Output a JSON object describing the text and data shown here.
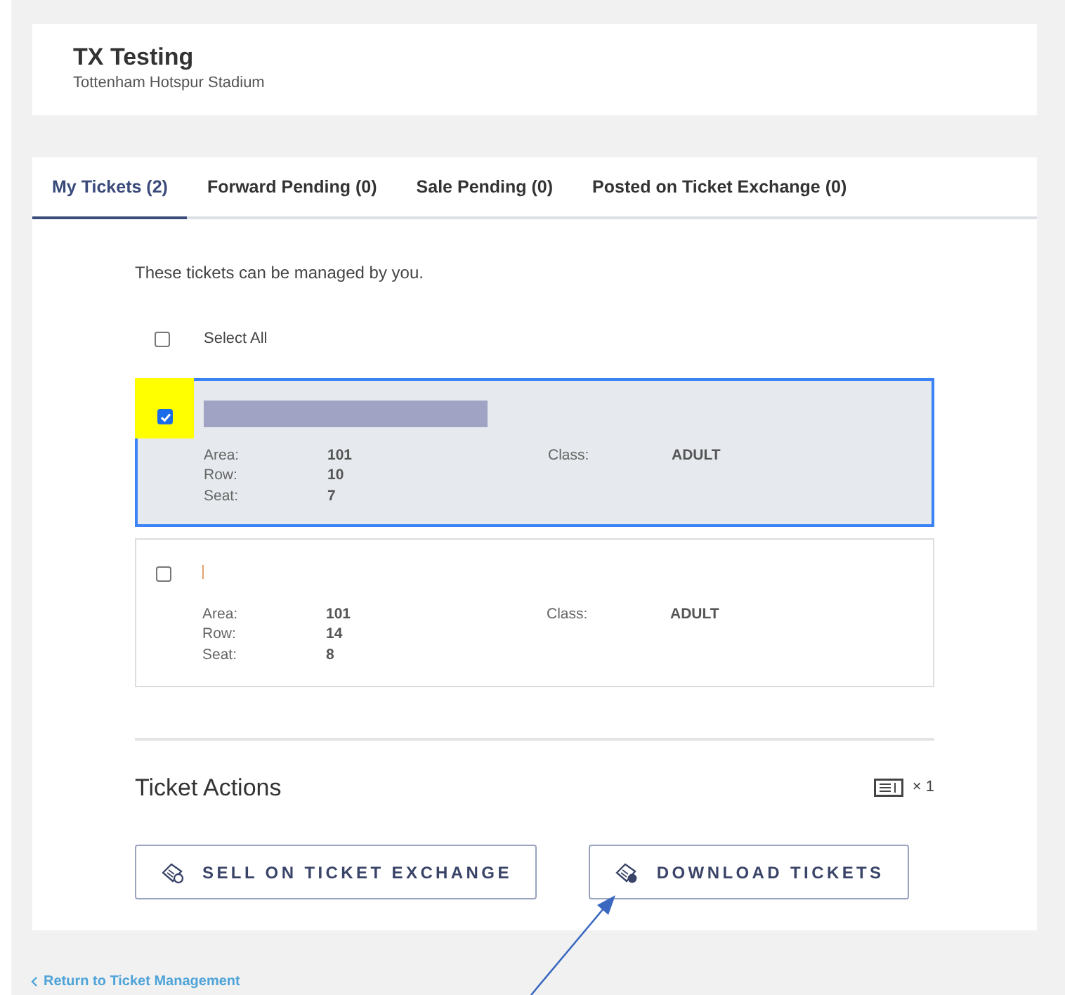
{
  "event": {
    "title": "TX Testing",
    "venue": "Tottenham Hotspur Stadium"
  },
  "tabs": [
    {
      "label": "My Tickets (2)",
      "selected": true
    },
    {
      "label": "Forward Pending (0)",
      "selected": false
    },
    {
      "label": "Sale Pending (0)",
      "selected": false
    },
    {
      "label": "Posted on Ticket Exchange (0)",
      "selected": false
    }
  ],
  "intro": "These tickets can be managed by you.",
  "select_all": {
    "label": "Select All",
    "checked": false
  },
  "tickets": [
    {
      "checked": true,
      "highlighted": true,
      "kind": "redacted",
      "fields": [
        {
          "label": "Area:",
          "value": "101"
        },
        {
          "label": "Row:",
          "value": "10"
        },
        {
          "label": "Seat:",
          "value": "7"
        }
      ],
      "class_label": "Class:",
      "class_value": "ADULT"
    },
    {
      "checked": false,
      "highlighted": false,
      "kind": "partial",
      "fields": [
        {
          "label": "Area:",
          "value": "101"
        },
        {
          "label": "Row:",
          "value": "14"
        },
        {
          "label": "Seat:",
          "value": "8"
        }
      ],
      "class_label": "Class:",
      "class_value": "ADULT"
    }
  ],
  "actions": {
    "title": "Ticket Actions",
    "count": "× 1",
    "buttons": [
      {
        "label": "SELL ON TICKET EXCHANGE",
        "kind": "sell"
      },
      {
        "label": "DOWNLOAD TICKETS",
        "kind": "download"
      }
    ]
  },
  "back_link": "Return to Ticket Management",
  "annotation": {
    "arrow": true
  }
}
